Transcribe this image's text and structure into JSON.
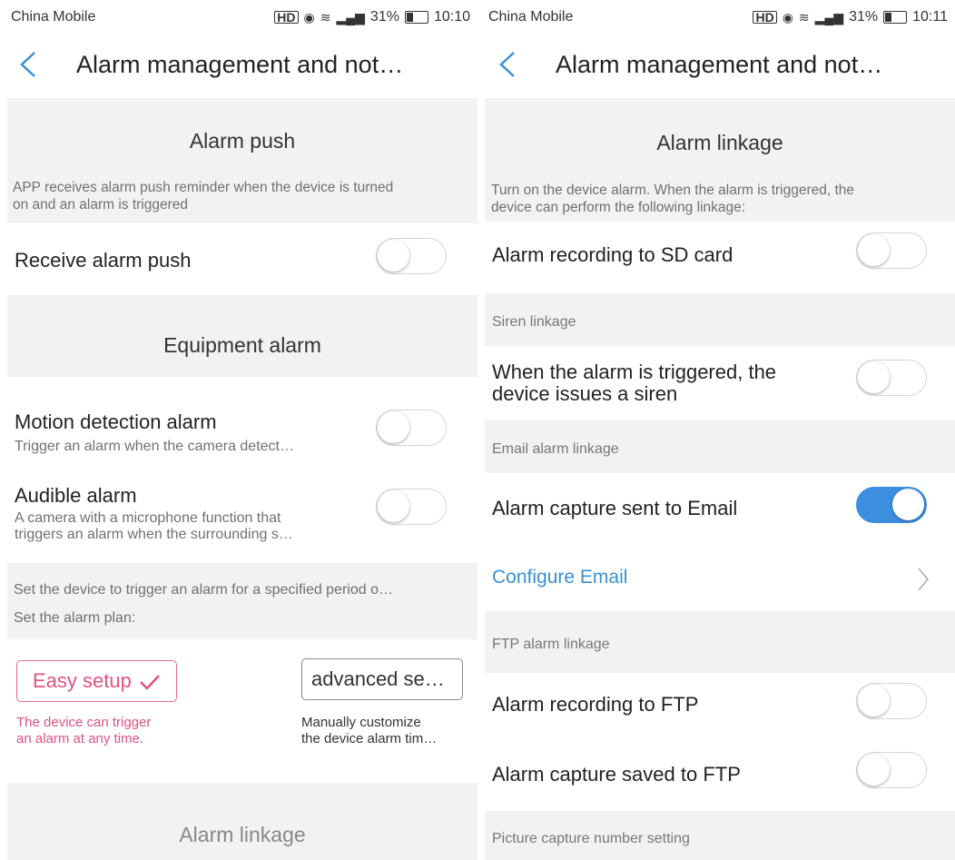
{
  "left": {
    "status": {
      "carrier": "China Mobile",
      "battery": "31%",
      "time": "10:10"
    },
    "title": "Alarm management and not…",
    "alarm_push": {
      "title": "Alarm push",
      "desc1": "APP receives alarm push reminder when the device is turned",
      "desc2": "on and an alarm is triggered",
      "receive_label": "Receive alarm push",
      "receive_on": false
    },
    "equipment": {
      "title": "Equipment alarm",
      "motion_label": "Motion detection alarm",
      "motion_sub": "Trigger an alarm when the camera detect…",
      "audible_label": "Audible alarm",
      "audible_sub1": "A camera with a microphone function that",
      "audible_sub2": "triggers an alarm when the surrounding s…"
    },
    "plan": {
      "desc": "Set the device to trigger an alarm for a specified period o…",
      "label": "Set the alarm plan:",
      "easy_label": "Easy setup",
      "easy_desc1": "The device can trigger",
      "easy_desc2": "an alarm at any time.",
      "advanced_label": "advanced se…",
      "advanced_desc1": "Manually customize",
      "advanced_desc2": "the device alarm tim…"
    },
    "linkage_title": "Alarm linkage"
  },
  "right": {
    "status": {
      "carrier": "China Mobile",
      "battery": "31%",
      "time": "10:11"
    },
    "title": "Alarm management and not…",
    "linkage": {
      "title": "Alarm linkage",
      "desc1": "Turn on the device alarm. When the alarm is triggered, the",
      "desc2": "device can perform the following linkage:",
      "sd_label": "Alarm recording to SD card"
    },
    "siren": {
      "head": "Siren linkage",
      "label1": "When the alarm is triggered, the",
      "label2": "device issues a siren"
    },
    "email": {
      "head": "Email alarm linkage",
      "capture_label": "Alarm capture sent to Email",
      "capture_on": true,
      "configure_label": "Configure Email"
    },
    "ftp": {
      "head": "FTP alarm linkage",
      "record_label": "Alarm recording to FTP",
      "capture_label": "Alarm capture saved to FTP"
    },
    "picture_head": "Picture capture number setting"
  },
  "colors": {
    "accent": "#3c8fe0",
    "easy": "#e0527f",
    "section_bg": "#f2f2f2"
  }
}
